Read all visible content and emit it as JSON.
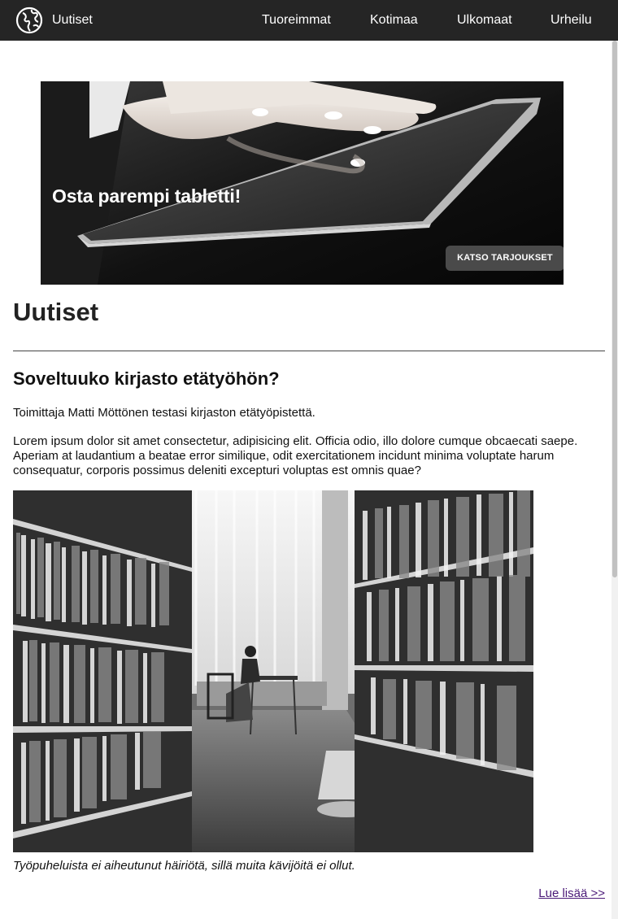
{
  "header": {
    "brand": "Uutiset",
    "nav": [
      "Tuoreimmat",
      "Kotimaa",
      "Ulkomaat",
      "Urheilu"
    ]
  },
  "ad": {
    "headline": "Osta parempi tabletti!",
    "cta": "KATSO TARJOUKSET"
  },
  "main": {
    "section_title": "Uutiset",
    "article": {
      "title": "Soveltuuko kirjasto etätyöhön?",
      "byline": "Toimittaja Matti Möttönen testasi kirjaston etätyöpistettä.",
      "body": "Lorem ipsum dolor sit amet consectetur, adipisicing elit. Officia odio, illo dolore cumque obcaecati saepe. Aperiam at laudantium a beatae error similique, odit exercitationem incidunt minima voluptate harum consequatur, corporis possimus deleniti excepturi voluptas est omnis quae?",
      "caption": "Työpuheluista ei aiheutunut häiriötä, sillä muita kävijöitä ei ollut.",
      "read_more": "Lue lisää >>"
    }
  },
  "colors": {
    "header_bg": "#252525",
    "link_visited": "#4b1a78"
  },
  "icons": {
    "logo": "globe-icon"
  }
}
